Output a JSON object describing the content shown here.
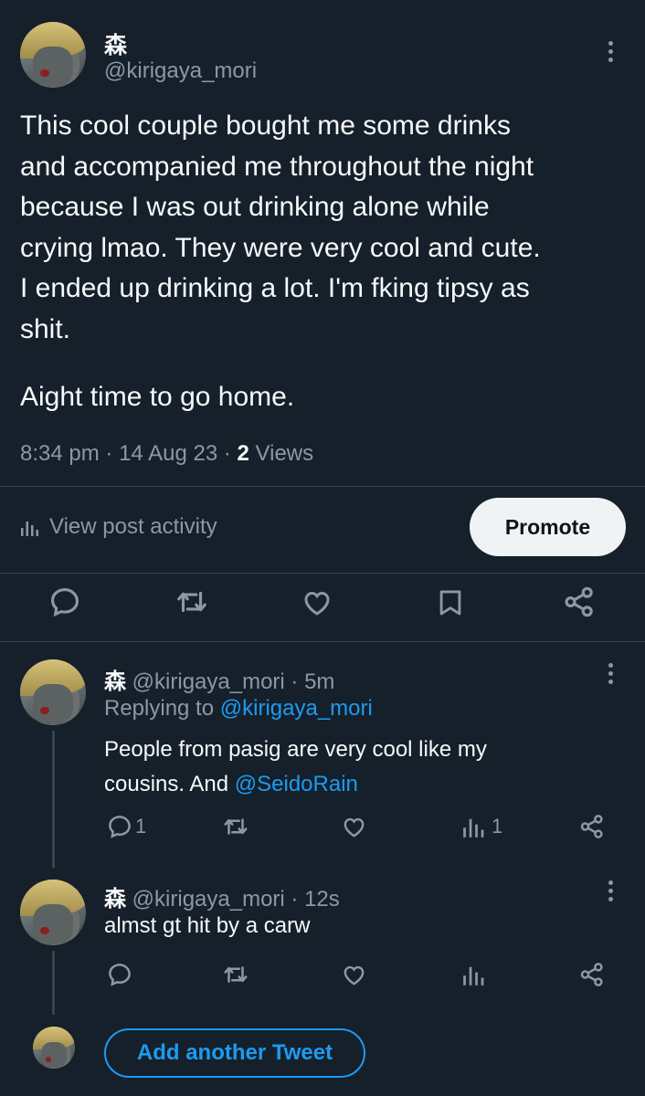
{
  "main_post": {
    "display_name": "森",
    "handle": "@kirigaya_mori",
    "text_lines": [
      "This cool couple bought me some drinks",
      "and accompanied me throughout the night",
      "because I was out drinking alone while",
      "crying lmao. They were very cool and cute.",
      "I ended up drinking a lot. I'm fking tipsy as",
      "shit."
    ],
    "text_last": "Aight time to go home.",
    "time": "8:34 pm",
    "date": "14 Aug 23",
    "views_count": "2",
    "views_label": "Views",
    "sep": "·",
    "activity_label": "View post activity",
    "promote_label": "Promote"
  },
  "reply1": {
    "display_name": "森",
    "handle": "@kirigaya_mori",
    "time": "5m",
    "replying_prefix": "Replying to",
    "replying_handle": "@kirigaya_mori",
    "text_line1": "People from pasig are very cool like my",
    "text_line2_prefix": "cousins. And",
    "text_mention": "@SeidoRain",
    "reply_count": "1",
    "views_count": "1"
  },
  "reply2": {
    "display_name": "森",
    "handle": "@kirigaya_mori",
    "time": "12s",
    "text": "almst gt hit by a carw"
  },
  "composer": {
    "add_label": "Add another Tweet"
  },
  "colors": {
    "background": "#15202b",
    "text": "#f7f9f9",
    "muted": "#8b98a5",
    "accent": "#1d9bf0"
  }
}
